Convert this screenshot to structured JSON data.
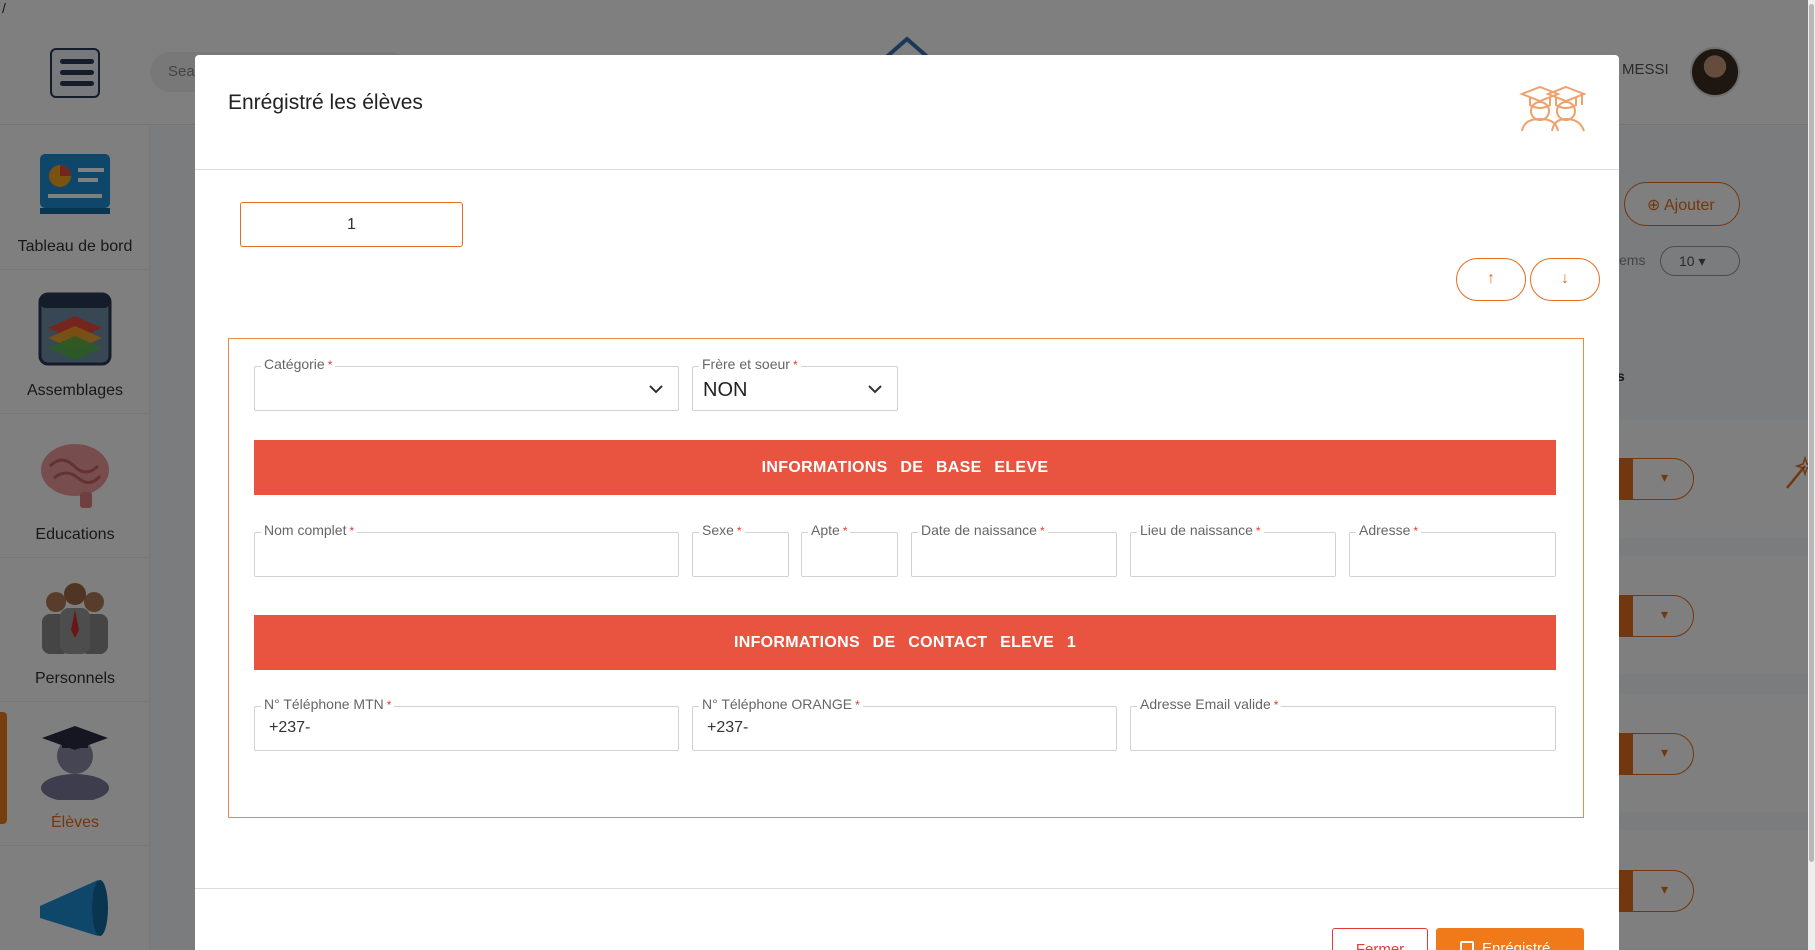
{
  "app": {
    "search_placeholder": "Sea",
    "user_name": "L MESSI",
    "slash": "/"
  },
  "sidebar": {
    "items": [
      {
        "label": "Tableau de bord",
        "icon": "dashboard-icon"
      },
      {
        "label": "Assemblages",
        "icon": "layers-folder-icon"
      },
      {
        "label": "Educations",
        "icon": "brain-icon"
      },
      {
        "label": "Personnels",
        "icon": "staff-group-icon"
      },
      {
        "label": "Élèves",
        "icon": "graduate-student-icon",
        "active": true
      },
      {
        "label": "",
        "icon": "megaphone-icon"
      }
    ]
  },
  "background": {
    "ajouter_label": "Ajouter",
    "items_label": "items",
    "items_value": "10",
    "partial_text": "s"
  },
  "modal": {
    "title": "Enrégistré les élèves",
    "count_value": "1",
    "up_arrow": "↑",
    "down_arrow": "↓",
    "fields": {
      "categorie": {
        "label": "Catégorie",
        "value": ""
      },
      "frere_soeur": {
        "label": "Frère et soeur",
        "value": "NON"
      },
      "nom_complet": {
        "label": "Nom complet",
        "value": ""
      },
      "sexe": {
        "label": "Sexe",
        "value": ""
      },
      "apte": {
        "label": "Apte",
        "value": ""
      },
      "date_naissance": {
        "label": "Date de naissance",
        "value": ""
      },
      "lieu_naissance": {
        "label": "Lieu de naissance",
        "value": ""
      },
      "adresse": {
        "label": "Adresse",
        "value": ""
      },
      "tel_mtn": {
        "label": "N° Téléphone MTN",
        "value": "+237-"
      },
      "tel_orange": {
        "label": "N° Téléphone ORANGE",
        "value": "+237-"
      },
      "email": {
        "label": "Adresse Email valide",
        "value": ""
      }
    },
    "required_mark": "*",
    "section_base": "INFORMATIONS DE BASE ELEVE",
    "section_contact": "INFORMATIONS DE CONTACT ELEVE 1",
    "btn_close": "Fermer",
    "btn_save": "Enrégistré"
  },
  "colors": {
    "accent": "#f07a1a",
    "band": "#e85440",
    "danger": "#e53935"
  }
}
